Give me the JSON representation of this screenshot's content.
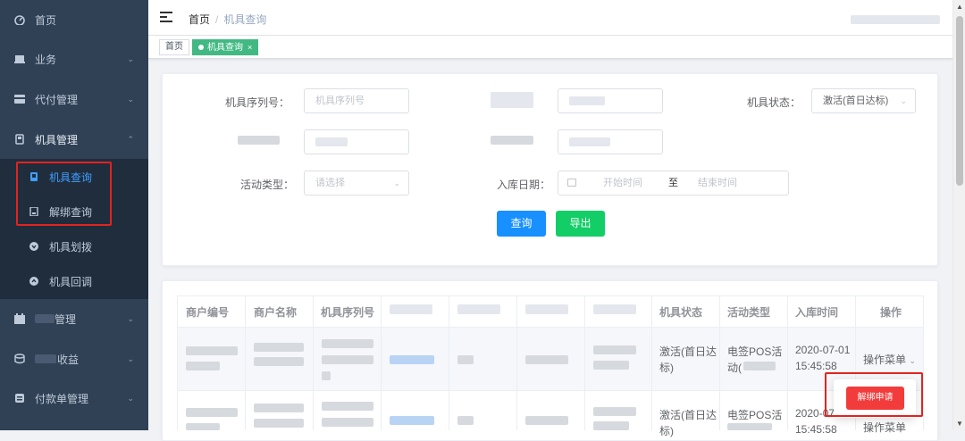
{
  "sidebar": {
    "items": [
      {
        "label": "首页",
        "icon": "dashboard-icon"
      },
      {
        "label": "业务",
        "icon": "business-icon"
      },
      {
        "label": "代付管理",
        "icon": "payment-icon"
      },
      {
        "label": "机具管理",
        "icon": "device-icon"
      },
      {
        "label": "管理",
        "icon": "calendar-icon"
      },
      {
        "label": "收益",
        "icon": "income-icon"
      },
      {
        "label": "付款单管理",
        "icon": "invoice-icon"
      }
    ],
    "sub_items": [
      {
        "label": "机具查询",
        "icon": "device-search-icon"
      },
      {
        "label": "解绑查询",
        "icon": "unbind-query-icon"
      },
      {
        "label": "机具划拨",
        "icon": "transfer-icon"
      },
      {
        "label": "机具回调",
        "icon": "recall-icon"
      }
    ],
    "arrow_collapsed": "⌄",
    "arrow_expanded": "⌃"
  },
  "header": {
    "breadcrumb_home": "首页",
    "breadcrumb_sep": "/",
    "breadcrumb_current": "机具查询"
  },
  "tags": {
    "home": "首页",
    "active": "机具查询",
    "close": "×"
  },
  "search": {
    "serial_label": "机具序列号：",
    "serial_placeholder": "机具序列号",
    "status_label": "机具状态：",
    "status_value": "激活(首日达标)",
    "activity_label": "活动类型：",
    "activity_placeholder": "请选择",
    "date_label": "入库日期：",
    "date_start_placeholder": "开始时间",
    "date_to": "至",
    "date_end_placeholder": "结束时间",
    "query_button": "查询",
    "export_button": "导出"
  },
  "table": {
    "headers": [
      "商户编号",
      "商户名称",
      "机具序列号",
      "",
      "",
      "",
      "",
      "机具状态",
      "活动类型",
      "入库时间",
      "操作"
    ],
    "rows": [
      {
        "status_1": "激活(首日达",
        "status_2": "标)",
        "activity_1": "电签POS活",
        "activity_2": "动(",
        "date": "2020-07-01",
        "time": "15:45:58",
        "action": "操作菜单"
      },
      {
        "status_1": "激活(首日达",
        "status_2": "标)",
        "activity_1": "电签POS活",
        "activity_2": "",
        "date": "2020-07-",
        "time": "15:45:58",
        "action": "操作菜单"
      }
    ]
  },
  "dropdown": {
    "unbind_label": "解绑申请"
  },
  "colors": {
    "sidebar_bg": "#304156",
    "submenu_bg": "#1f2d3d",
    "active_blue": "#409eff",
    "tag_green": "#42b983",
    "query_blue": "#1890ff",
    "export_green": "#13ce66",
    "highlight_red": "#e3231f",
    "unbind_red": "#f23c3c"
  }
}
